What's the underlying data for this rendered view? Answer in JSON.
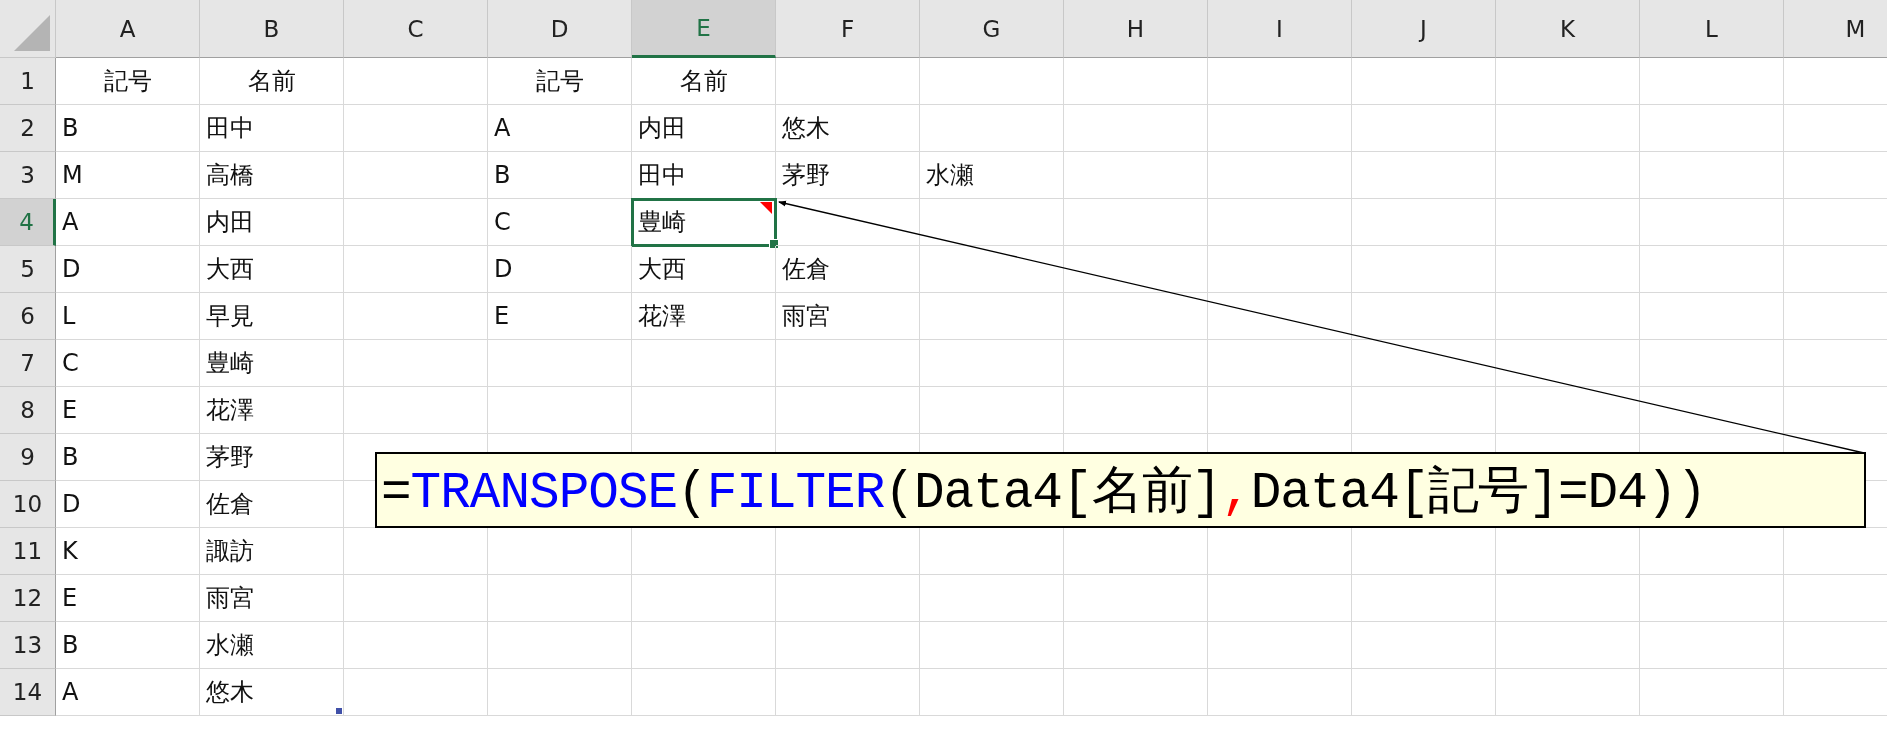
{
  "columns": [
    {
      "label": "A",
      "selected": false
    },
    {
      "label": "B",
      "selected": false
    },
    {
      "label": "C",
      "selected": false
    },
    {
      "label": "D",
      "selected": false
    },
    {
      "label": "E",
      "selected": true
    },
    {
      "label": "F",
      "selected": false
    },
    {
      "label": "G",
      "selected": false
    },
    {
      "label": "H",
      "selected": false
    },
    {
      "label": "I",
      "selected": false
    },
    {
      "label": "J",
      "selected": false
    },
    {
      "label": "K",
      "selected": false
    },
    {
      "label": "L",
      "selected": false
    },
    {
      "label": "M",
      "selected": false
    }
  ],
  "rows": [
    {
      "number": "1",
      "selected": false,
      "cells": [
        {
          "text": "記号",
          "kind": "heading",
          "selected": false,
          "comment": false
        },
        {
          "text": "名前",
          "kind": "heading",
          "selected": false,
          "comment": false
        },
        null,
        {
          "text": "記号",
          "kind": "heading",
          "selected": false,
          "comment": false
        },
        {
          "text": "名前",
          "kind": "heading",
          "selected": false,
          "comment": false
        },
        null,
        null,
        null,
        null,
        null,
        null,
        null,
        null
      ]
    },
    {
      "number": "2",
      "selected": false,
      "cells": [
        {
          "text": "B",
          "kind": "value",
          "selected": false,
          "comment": false
        },
        {
          "text": "田中",
          "kind": "value",
          "selected": false,
          "comment": false
        },
        null,
        {
          "text": "A",
          "kind": "value",
          "selected": false,
          "comment": false
        },
        {
          "text": "内田",
          "kind": "value",
          "selected": false,
          "comment": false
        },
        {
          "text": "悠木",
          "kind": "value",
          "selected": false,
          "comment": false
        },
        null,
        null,
        null,
        null,
        null,
        null,
        null
      ]
    },
    {
      "number": "3",
      "selected": false,
      "cells": [
        {
          "text": "M",
          "kind": "value",
          "selected": false,
          "comment": false
        },
        {
          "text": "高橋",
          "kind": "value",
          "selected": false,
          "comment": false
        },
        null,
        {
          "text": "B",
          "kind": "value",
          "selected": false,
          "comment": false
        },
        {
          "text": "田中",
          "kind": "value",
          "selected": false,
          "comment": false
        },
        {
          "text": "茅野",
          "kind": "value",
          "selected": false,
          "comment": false
        },
        {
          "text": "水瀬",
          "kind": "value",
          "selected": false,
          "comment": false
        },
        null,
        null,
        null,
        null,
        null,
        null
      ]
    },
    {
      "number": "4",
      "selected": true,
      "cells": [
        {
          "text": "A",
          "kind": "value",
          "selected": false,
          "comment": false
        },
        {
          "text": "内田",
          "kind": "value",
          "selected": false,
          "comment": false
        },
        null,
        {
          "text": "C",
          "kind": "value",
          "selected": false,
          "comment": false
        },
        {
          "text": "豊崎",
          "kind": "value",
          "selected": true,
          "comment": true
        },
        null,
        null,
        null,
        null,
        null,
        null,
        null,
        null
      ]
    },
    {
      "number": "5",
      "selected": false,
      "cells": [
        {
          "text": "D",
          "kind": "value",
          "selected": false,
          "comment": false
        },
        {
          "text": "大西",
          "kind": "value",
          "selected": false,
          "comment": false
        },
        null,
        {
          "text": "D",
          "kind": "value",
          "selected": false,
          "comment": false
        },
        {
          "text": "大西",
          "kind": "value",
          "selected": false,
          "comment": false
        },
        {
          "text": "佐倉",
          "kind": "value",
          "selected": false,
          "comment": false
        },
        null,
        null,
        null,
        null,
        null,
        null,
        null
      ]
    },
    {
      "number": "6",
      "selected": false,
      "cells": [
        {
          "text": "L",
          "kind": "value",
          "selected": false,
          "comment": false
        },
        {
          "text": "早見",
          "kind": "value",
          "selected": false,
          "comment": false
        },
        null,
        {
          "text": "E",
          "kind": "value",
          "selected": false,
          "comment": false
        },
        {
          "text": "花澤",
          "kind": "value",
          "selected": false,
          "comment": false
        },
        {
          "text": "雨宮",
          "kind": "value",
          "selected": false,
          "comment": false
        },
        null,
        null,
        null,
        null,
        null,
        null,
        null
      ]
    },
    {
      "number": "7",
      "selected": false,
      "cells": [
        {
          "text": "C",
          "kind": "value",
          "selected": false,
          "comment": false
        },
        {
          "text": "豊崎",
          "kind": "value",
          "selected": false,
          "comment": false
        },
        null,
        null,
        null,
        null,
        null,
        null,
        null,
        null,
        null,
        null,
        null
      ]
    },
    {
      "number": "8",
      "selected": false,
      "cells": [
        {
          "text": "E",
          "kind": "value",
          "selected": false,
          "comment": false
        },
        {
          "text": "花澤",
          "kind": "value",
          "selected": false,
          "comment": false
        },
        null,
        null,
        null,
        null,
        null,
        null,
        null,
        null,
        null,
        null,
        null
      ]
    },
    {
      "number": "9",
      "selected": false,
      "cells": [
        {
          "text": "B",
          "kind": "value",
          "selected": false,
          "comment": false
        },
        {
          "text": "茅野",
          "kind": "value",
          "selected": false,
          "comment": false
        },
        null,
        null,
        null,
        null,
        null,
        null,
        null,
        null,
        null,
        null,
        null
      ]
    },
    {
      "number": "10",
      "selected": false,
      "cells": [
        {
          "text": "D",
          "kind": "value",
          "selected": false,
          "comment": false
        },
        {
          "text": "佐倉",
          "kind": "value",
          "selected": false,
          "comment": false
        },
        null,
        null,
        null,
        null,
        null,
        null,
        null,
        null,
        null,
        null,
        null
      ]
    },
    {
      "number": "11",
      "selected": false,
      "cells": [
        {
          "text": "K",
          "kind": "value",
          "selected": false,
          "comment": false
        },
        {
          "text": "諏訪",
          "kind": "value",
          "selected": false,
          "comment": false
        },
        null,
        null,
        null,
        null,
        null,
        null,
        null,
        null,
        null,
        null,
        null
      ]
    },
    {
      "number": "12",
      "selected": false,
      "cells": [
        {
          "text": "E",
          "kind": "value",
          "selected": false,
          "comment": false
        },
        {
          "text": "雨宮",
          "kind": "value",
          "selected": false,
          "comment": false
        },
        null,
        null,
        null,
        null,
        null,
        null,
        null,
        null,
        null,
        null,
        null
      ]
    },
    {
      "number": "13",
      "selected": false,
      "cells": [
        {
          "text": "B",
          "kind": "value",
          "selected": false,
          "comment": false
        },
        {
          "text": "水瀬",
          "kind": "value",
          "selected": false,
          "comment": false
        },
        null,
        null,
        null,
        null,
        null,
        null,
        null,
        null,
        null,
        null,
        null
      ]
    },
    {
      "number": "14",
      "selected": false,
      "cells": [
        {
          "text": "A",
          "kind": "value",
          "selected": false,
          "comment": false
        },
        {
          "text": "悠木",
          "kind": "value",
          "selected": false,
          "comment": false
        },
        null,
        null,
        null,
        null,
        null,
        null,
        null,
        null,
        null,
        null,
        null
      ]
    }
  ],
  "callout": {
    "segments": [
      {
        "text": "=",
        "kind": "plain"
      },
      {
        "text": "TRANSPOSE",
        "kind": "function"
      },
      {
        "text": "(",
        "kind": "plain"
      },
      {
        "text": "FILTER",
        "kind": "function"
      },
      {
        "text": "(Data4[名前]",
        "kind": "plain"
      },
      {
        "text": ",",
        "kind": "separator"
      },
      {
        "text": "Data4[記号]=D4))",
        "kind": "plain"
      }
    ]
  }
}
